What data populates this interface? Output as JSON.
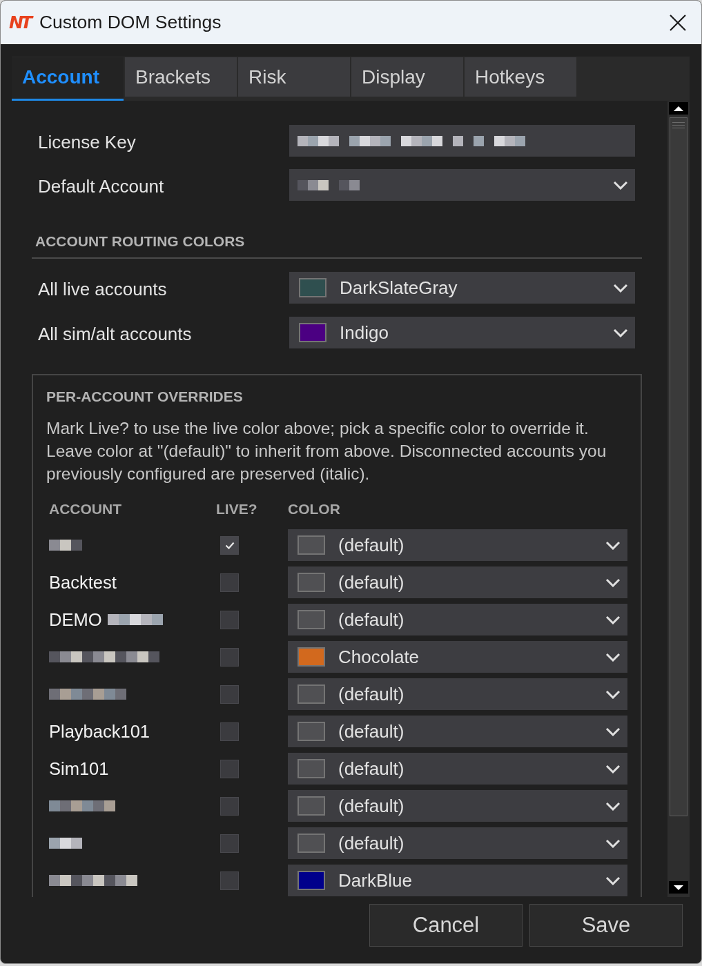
{
  "window": {
    "logo": "NT",
    "title": "Custom DOM Settings"
  },
  "tabs": [
    {
      "label": "Account",
      "selected": true
    },
    {
      "label": "Brackets",
      "selected": false
    },
    {
      "label": "Risk",
      "selected": false
    },
    {
      "label": "Display",
      "selected": false
    },
    {
      "label": "Hotkeys",
      "selected": false
    }
  ],
  "account_fields": [
    {
      "label": "License Key",
      "kind": "text",
      "redacted": true
    },
    {
      "label": "Default Account",
      "kind": "dropdown",
      "redacted": true
    }
  ],
  "routing_colors": {
    "heading": "ACCOUNT ROUTING COLORS",
    "items": [
      {
        "label": "All live accounts",
        "value": "DarkSlateGray",
        "color": "#2f4f4f"
      },
      {
        "label": "All sim/alt accounts",
        "value": "Indigo",
        "color": "#4b0082"
      }
    ]
  },
  "overrides": {
    "heading": "PER-ACCOUNT OVERRIDES",
    "description": "Mark Live? to use the live color above; pick a specific color to override it. Leave color at \"(default)\" to inherit from above. Disconnected accounts you previously configured are preserved (italic).",
    "columns": [
      "ACCOUNT",
      "LIVE?",
      "COLOR"
    ],
    "rows": [
      {
        "redacted": true,
        "live": true,
        "color_name": "(default)",
        "color": "#505053"
      },
      {
        "account": "Backtest",
        "redacted": false,
        "live": false,
        "color_name": "(default)",
        "color": "#505053"
      },
      {
        "account": "DEMO",
        "redacted": true,
        "live": false,
        "color_name": "(default)",
        "color": "#505053"
      },
      {
        "redacted": true,
        "live": false,
        "color_name": "Chocolate",
        "color": "#d2691e"
      },
      {
        "redacted": true,
        "live": false,
        "color_name": "(default)",
        "color": "#505053"
      },
      {
        "account": "Playback101",
        "redacted": false,
        "live": false,
        "color_name": "(default)",
        "color": "#505053"
      },
      {
        "account": "Sim101",
        "redacted": false,
        "live": false,
        "color_name": "(default)",
        "color": "#505053"
      },
      {
        "redacted": true,
        "live": false,
        "color_name": "(default)",
        "color": "#505053"
      },
      {
        "redacted": true,
        "live": false,
        "color_name": "(default)",
        "color": "#505053"
      },
      {
        "redacted": true,
        "live": false,
        "color_name": "DarkBlue",
        "color": "#00008b"
      }
    ]
  },
  "buttons": [
    "Cancel",
    "Save"
  ]
}
